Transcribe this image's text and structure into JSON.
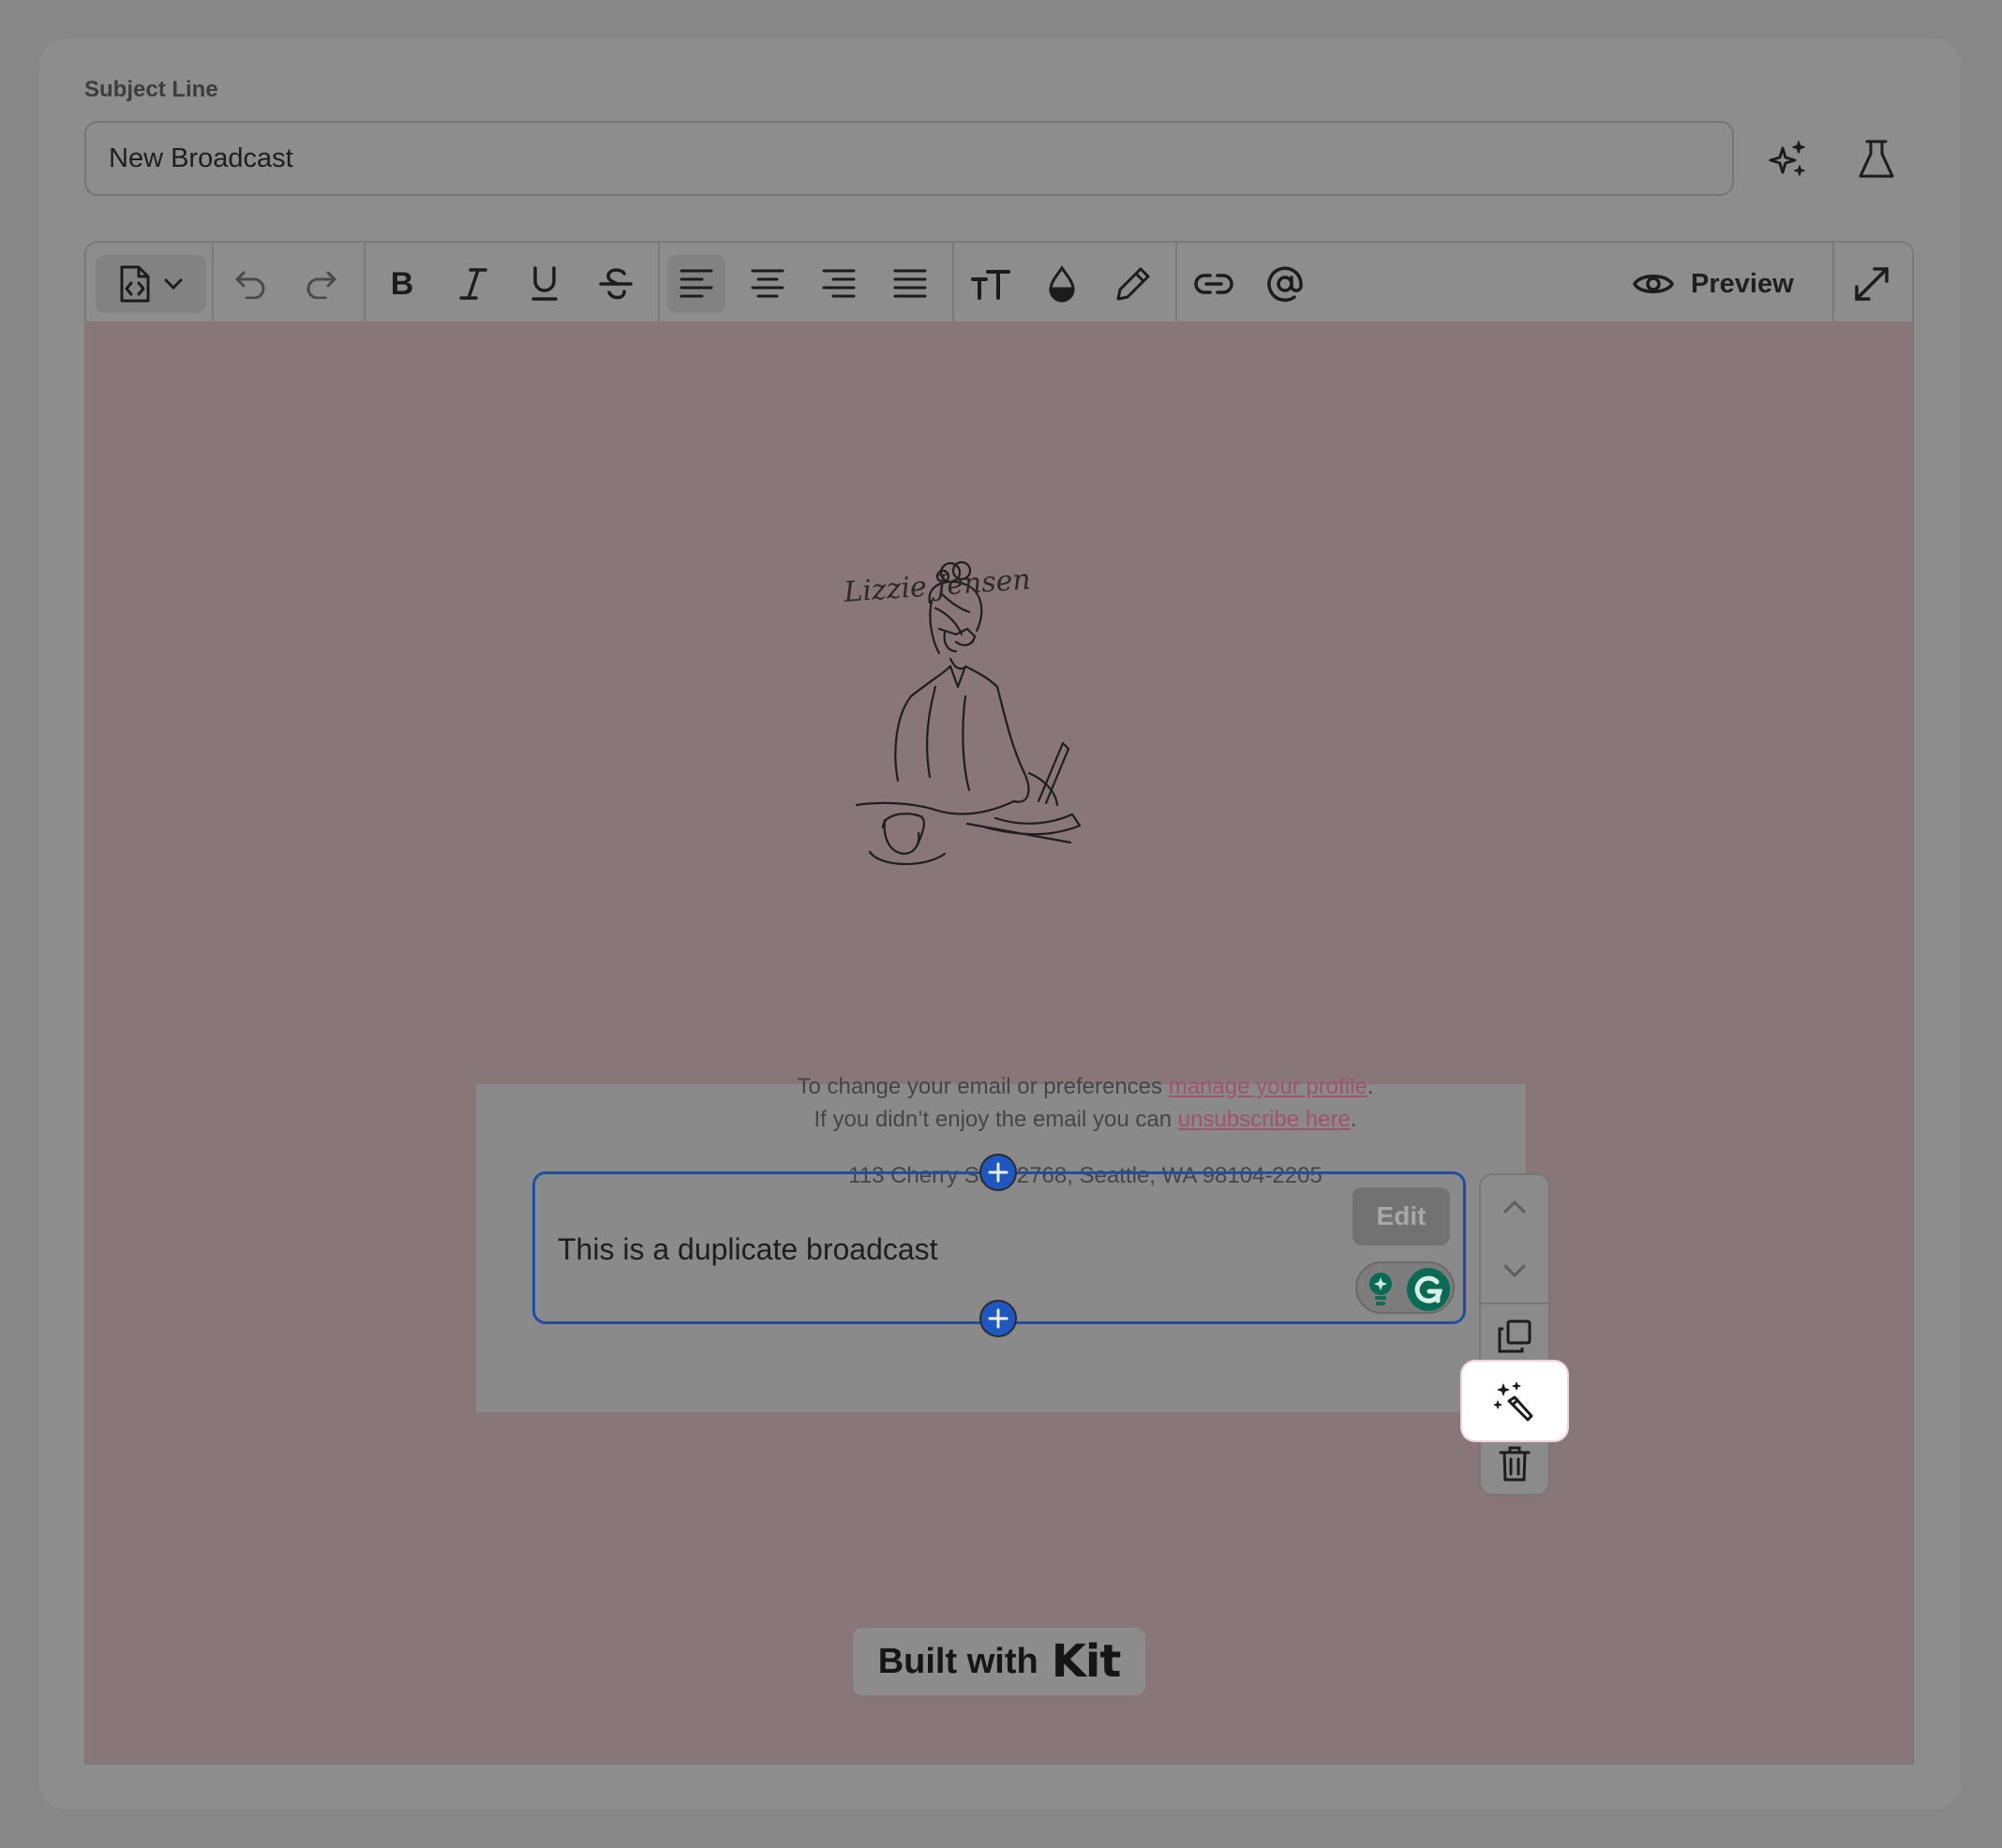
{
  "subject": {
    "label": "Subject Line",
    "value": "New Broadcast"
  },
  "top_actions": {
    "ai_icon": "sparkles-icon",
    "test_icon": "flask-icon"
  },
  "toolbar": {
    "preview_label": "Preview",
    "items": [
      "template-menu",
      "undo",
      "redo",
      "bold",
      "italic",
      "underline",
      "strikethrough",
      "align-left",
      "align-center",
      "align-right",
      "align-justify",
      "text-size",
      "color",
      "highlight",
      "link",
      "mention",
      "preview",
      "fullscreen"
    ],
    "active": "align-left"
  },
  "email": {
    "logo_signature": "Lizzie Jensen",
    "body_text": "This is a duplicate broadcast",
    "edit_label": "Edit",
    "footer_line1_prefix": "To change your email or preferences ",
    "footer_line1_link": "manage your profile",
    "footer_line1_suffix": ".",
    "footer_line2_prefix": "If you didn’t enjoy the email you can ",
    "footer_line2_link": "unsubscribe here",
    "footer_line2_suffix": ".",
    "address": "113 Cherry St #92768, Seattle, WA 98104-2205",
    "badge_prefix": "Built with",
    "badge_brand": "Kit"
  },
  "block_menu": {
    "items": [
      "move-up",
      "move-down",
      "duplicate",
      "ai-rewrite",
      "delete"
    ],
    "highlighted": "ai-rewrite"
  },
  "colors": {
    "overlay": "#878787",
    "canvas": "#887678",
    "accent_blue": "#1e57c0",
    "link": "#a2536c",
    "grammarly": "#0a6b54"
  }
}
